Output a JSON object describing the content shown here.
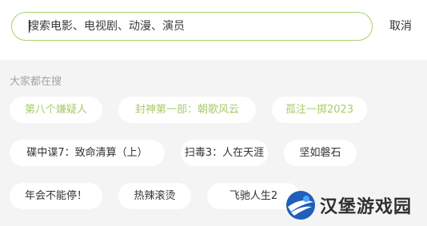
{
  "search": {
    "placeholder": "搜索电影、电视剧、动漫、演员",
    "cancel_label": "取消"
  },
  "hot_search": {
    "title": "大家都在搜",
    "items": [
      {
        "label": "第八个嫌疑人",
        "highlighted": true
      },
      {
        "label": "封神第一部：朝歌风云",
        "highlighted": true
      },
      {
        "label": "孤注一掷2023",
        "highlighted": true
      },
      {
        "label": "碟中谍7：致命清算（上）",
        "highlighted": false
      },
      {
        "label": "扫毒3：人在天涯",
        "highlighted": false
      },
      {
        "label": "坚如磐石",
        "highlighted": false
      },
      {
        "label": "年会不能停！",
        "highlighted": false
      },
      {
        "label": "热辣滚烫",
        "highlighted": false
      },
      {
        "label": "飞驰人生2",
        "highlighted": false
      }
    ]
  },
  "watermark": {
    "text": "汉堡游戏园"
  },
  "colors": {
    "accent": "#a9cc6a",
    "background": "#f4f4f4",
    "text": "#333333",
    "muted": "#a3a3a3"
  }
}
